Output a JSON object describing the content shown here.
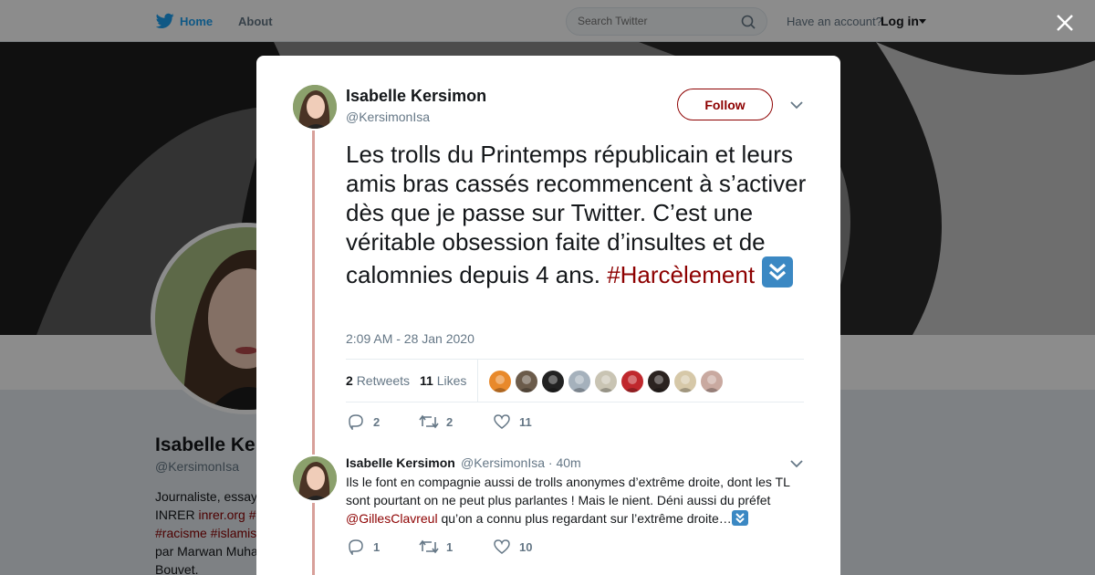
{
  "nav": {
    "home_label": "Home",
    "about_label": "About",
    "search_placeholder": "Search Twitter",
    "have_account": "Have an account?",
    "login_label": "Log in"
  },
  "profile": {
    "name": "Isabelle Ke",
    "handle": "@KersimonIsa",
    "bio_lines": [
      {
        "text": "Journaliste, essay",
        "link": ""
      },
      {
        "text": "INRER ",
        "link": "inrer.org #"
      },
      {
        "text": "",
        "link": "#racisme #islamis"
      },
      {
        "text": "par Marwan Muha",
        "link": ""
      },
      {
        "text": "Bouvet.",
        "link": ""
      }
    ]
  },
  "tweet": {
    "author_name": "Isabelle Kersimon",
    "author_handle": "@KersimonIsa",
    "follow_label": "Follow",
    "text": "Les trolls du Printemps républicain et leurs amis bras cassés recommencent à s’activer dès que je passe sur Twitter. C’est une véritable obsession faite d’insultes et de calomnies depuis 4 ans.",
    "hashtag": "#Harcèlement",
    "emoji": "down-arrow-emoji",
    "timestamp": "2:09 AM - 28 Jan 2020",
    "retweets_count": "2",
    "retweets_label": "Retweets",
    "likes_count": "11",
    "likes_label": "Likes",
    "likers": [
      "#e8892b",
      "#6b5b4a",
      "#222222",
      "#a5b1bc",
      "#c9c4b3",
      "#c0282d",
      "#2b2320",
      "#d6c8a8",
      "#c9a9a0"
    ],
    "replies_action": "2",
    "retweets_action": "2",
    "likes_action": "11"
  },
  "reply": {
    "author_name": "Isabelle Kersimon",
    "author_handle": "@KersimonIsa",
    "time": "40m",
    "text_before": "Ils le font en compagnie aussi de trolls anonymes d’extrême droite, dont les TL sont pourtant on ne peut plus parlantes ! Mais le nient. Déni aussi du préfet ",
    "mention": "@GillesClavreul",
    "text_after": " qu’on a connu plus regardant sur l’extrême droite…",
    "replies_action": "1",
    "retweets_action": "1",
    "likes_action": "10"
  },
  "colors": {
    "link": "#8d0000",
    "twitter_blue": "#1da1f2",
    "thread_line": "#d8a09a",
    "emoji_blue": "#3b88c3"
  }
}
